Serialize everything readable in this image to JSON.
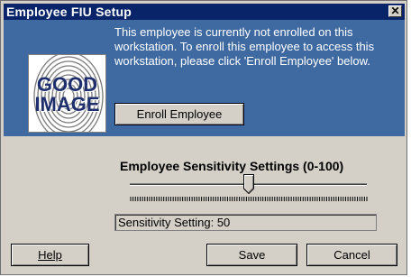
{
  "window": {
    "title": "Employee FIU Setup",
    "close_icon": "close-icon"
  },
  "banner": {
    "message": "This employee is currently not enrolled on this workstation.  To enroll this employee to access this workstation, please click 'Enroll Employee' below.",
    "enroll_label": "Enroll Employee",
    "image_label_line1": "GOOD",
    "image_label_line2": "IMAGE"
  },
  "sensitivity": {
    "heading": "Employee Sensitivity Settings (0-100)",
    "value": 50,
    "status_text": "Sensitivity Setting: 50"
  },
  "buttons": {
    "help": "Help",
    "save": "Save",
    "cancel": "Cancel"
  },
  "colors": {
    "titlebar": "#0a246a",
    "banner": "#3f6aa1",
    "face": "#d4d0c8"
  }
}
